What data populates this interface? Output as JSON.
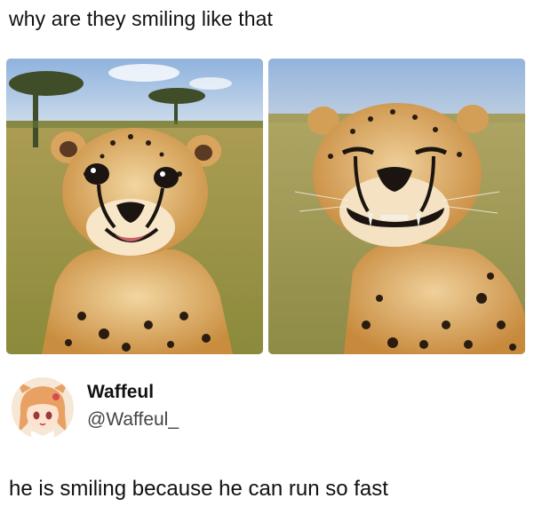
{
  "post": {
    "caption": "why are they smiling like that"
  },
  "images": [
    {
      "name": "cheetah-smiling-open-eyes"
    },
    {
      "name": "cheetah-grinning-closed-eyes"
    }
  ],
  "reply": {
    "display_name": "Waffeul",
    "handle": "@Waffeul_",
    "text": "he is smiling because he can run so fast",
    "avatar": "anime-girl-avatar"
  },
  "colors": {
    "text": "#111111",
    "handle": "#444444",
    "background": "#ffffff"
  }
}
